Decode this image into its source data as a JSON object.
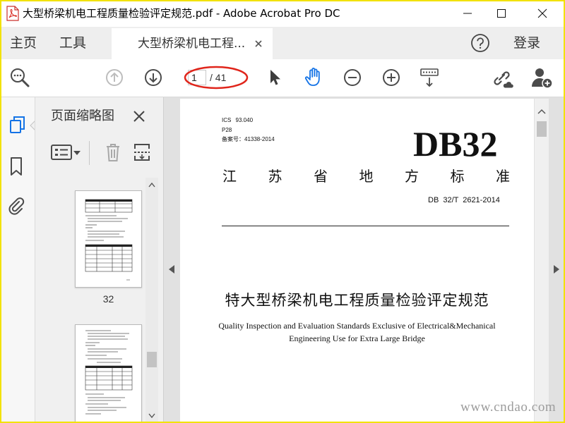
{
  "window": {
    "title": "大型桥梁机电工程质量检验评定规范.pdf - Adobe Acrobat Pro DC"
  },
  "nav": {
    "home": "主页",
    "tools": "工具",
    "document_tab": "大型桥梁机电工程...",
    "sign_in": "登录"
  },
  "toolbar": {
    "page_current": "1",
    "page_total": "/ 41",
    "active_tool": "hand-icon"
  },
  "thumbnail_panel": {
    "title": "页面缩略图",
    "pages": [
      {
        "label": "32"
      }
    ]
  },
  "document": {
    "ics": "ICS 93.040",
    "ccs": "P28",
    "record_no": "备案号：41338-2014",
    "standard_code": "DB32",
    "standard_type": "江苏省地方标准",
    "standard_number": "DB 32/T 2621-2014",
    "title_zh": "特大型桥梁机电工程质量检验评定规范",
    "title_en_line1": "Quality Inspection and Evaluation Standards Exclusive of Electrical&Mechanical",
    "title_en_line2": "Engineering Use for Extra Large Bridge"
  },
  "watermark": "www.cndao.com",
  "colors": {
    "accent": "#1473e6",
    "annotation": "#e0251b",
    "frame": "#f2e200",
    "watermark": "#9c9c9c"
  },
  "icons": {
    "toolbar": [
      "find-icon",
      "previous-page-icon",
      "next-page-icon",
      "select-cursor-icon",
      "hand-icon",
      "zoom-out-icon",
      "zoom-in-icon",
      "scrolling-mode-icon",
      "share-link-icon",
      "add-user-icon"
    ],
    "left_rail": [
      "page-thumbnails-icon",
      "bookmark-icon",
      "paperclip-icon"
    ],
    "panel": [
      "options-icon",
      "trash-icon",
      "insert-pages-icon"
    ]
  }
}
